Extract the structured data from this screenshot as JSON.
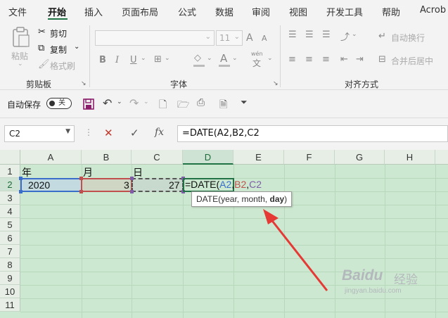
{
  "ribbon_tabs": [
    "文件",
    "开始",
    "插入",
    "页面布局",
    "公式",
    "数据",
    "审阅",
    "视图",
    "开发工具",
    "帮助",
    "Acrob"
  ],
  "clipboard": {
    "paste": "粘贴",
    "cut": "剪切",
    "copy": "复制",
    "format_painter": "格式刷",
    "group_label": "剪贴板"
  },
  "font": {
    "size": "11",
    "group_label": "字体",
    "bold": "B",
    "italic": "I",
    "underline": "U",
    "grow": "A",
    "shrink": "A",
    "font_color": "A",
    "wen": "wén",
    "wen_char": "文"
  },
  "alignment": {
    "wrap_text": "自动换行",
    "merge_center": "合并后居中",
    "group_label": "对齐方式"
  },
  "qat": {
    "autosave_label": "自动保存",
    "autosave_state": "关"
  },
  "formula_bar": {
    "name_box": "C2",
    "fx": "fx",
    "formula": "=DATE(A2,B2,C2"
  },
  "grid": {
    "columns": [
      "A",
      "B",
      "C",
      "D",
      "E",
      "F",
      "G",
      "H"
    ],
    "selected_column": "D",
    "rows": [
      "1",
      "2",
      "3",
      "4",
      "5",
      "6",
      "7",
      "8",
      "9",
      "10",
      "11"
    ],
    "selected_row": "2",
    "cells": {
      "A1": "年",
      "B1": "月",
      "C1": "日",
      "A2": "2020",
      "B2": "3",
      "C2": "27"
    },
    "edit_prefix": "=DATE(",
    "edit_a2": "A2",
    "edit_b2": "B2",
    "edit_c2": "C2",
    "tooltip_func": "DATE(year, month, ",
    "tooltip_bold": "day",
    "tooltip_close": ")"
  },
  "colors": {
    "excel_green": "#217346",
    "grid_bg": "#cde8d0",
    "ref_a2": "#3b6ec9",
    "ref_b2": "#c0504d",
    "ref_c2": "#7e5ea8",
    "arrow": "#e53935"
  },
  "watermark": {
    "brand": "Baidu",
    "cn": "经验",
    "url": "jingyan.baidu.com"
  }
}
